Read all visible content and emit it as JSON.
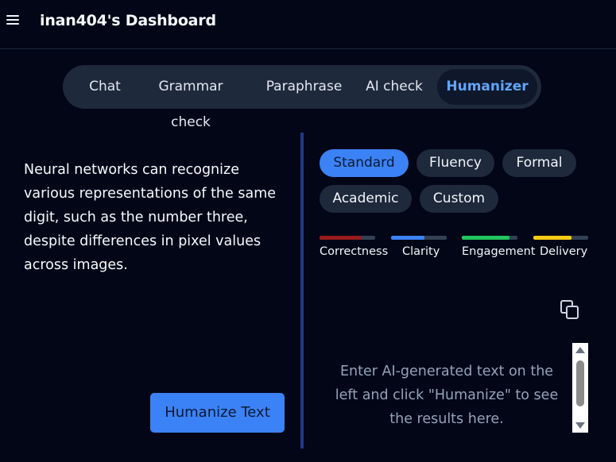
{
  "header": {
    "title": "inan404's Dashboard",
    "menu_icon": "hamburger-menu-icon"
  },
  "tabs": [
    {
      "label": "Chat",
      "active": false
    },
    {
      "label": "Grammar check",
      "active": false
    },
    {
      "label": "Paraphrase",
      "active": false
    },
    {
      "label": "AI check",
      "active": false
    },
    {
      "label": "Humanizer",
      "active": true
    }
  ],
  "input": {
    "text": "Neural networks can recognize various representations of the same digit, such as the number three, despite differences in pixel values across images."
  },
  "humanize_button": {
    "label": "Humanize Text"
  },
  "modes": [
    {
      "label": "Standard",
      "active": true
    },
    {
      "label": "Fluency",
      "active": false
    },
    {
      "label": "Formal",
      "active": false
    },
    {
      "label": "Academic",
      "active": false
    },
    {
      "label": "Custom",
      "active": false
    }
  ],
  "metrics": [
    {
      "label": "Correctness",
      "level": 0.75,
      "color": "#991b1b"
    },
    {
      "label": "Clarity",
      "level": 0.6,
      "color": "#3b82f6"
    },
    {
      "label": "Engagement",
      "level": 0.85,
      "color": "#22c55e"
    },
    {
      "label": "Delivery",
      "level": 0.7,
      "color": "#facc15"
    }
  ],
  "output": {
    "placeholder": "Enter AI-generated text on the left and click \"Humanize\" to see the results here.",
    "copy_icon": "copy-icon"
  },
  "colors": {
    "background": "#020617",
    "accent": "#3b82f6",
    "active_tab_text": "#60a5fa",
    "pill_background": "#1e293b"
  }
}
